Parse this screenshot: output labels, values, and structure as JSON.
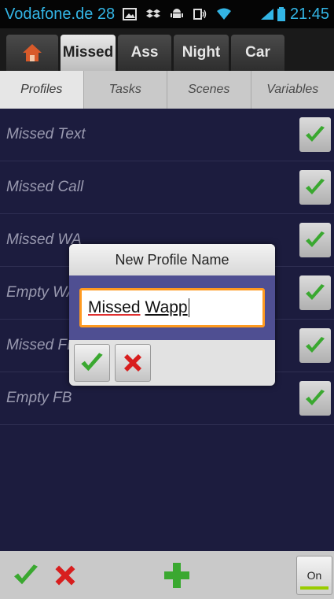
{
  "status_bar": {
    "carrier": "Vodafone.de 28",
    "icons": [
      "image-icon",
      "dropbox-icon",
      "android-icon",
      "nfc-icon",
      "wifi-icon",
      "signal-icon",
      "battery-icon"
    ],
    "time": "21:45"
  },
  "project_tabs": [
    {
      "label": "",
      "icon": "home-icon",
      "active": false
    },
    {
      "label": "Missed",
      "active": true
    },
    {
      "label": "Ass",
      "active": false
    },
    {
      "label": "Night",
      "active": false
    },
    {
      "label": "Car",
      "active": false
    }
  ],
  "sub_tabs": [
    {
      "label": "Profiles",
      "active": true
    },
    {
      "label": "Tasks",
      "active": false
    },
    {
      "label": "Scenes",
      "active": false
    },
    {
      "label": "Variables",
      "active": false
    }
  ],
  "profiles": [
    {
      "name": "Missed Text",
      "enabled": true
    },
    {
      "name": "Missed Call",
      "enabled": true
    },
    {
      "name": "Missed WA",
      "enabled": true
    },
    {
      "name": "Empty WA",
      "enabled": true
    },
    {
      "name": "Missed FB",
      "enabled": true
    },
    {
      "name": "Empty FB",
      "enabled": true
    }
  ],
  "dialog": {
    "title": "New Profile Name",
    "input_word1": "Missed",
    "input_word2": "Wapp",
    "input_value": "Missed Wapp"
  },
  "bottom_bar": {
    "on_label": "On"
  },
  "colors": {
    "accent_blue": "#33b5e5",
    "list_background": "#1c1c3e",
    "dialog_input_border": "#ff9a20",
    "check_green": "#3aa830",
    "cross_red": "#d81e1e",
    "on_indicator": "#99cc00"
  }
}
